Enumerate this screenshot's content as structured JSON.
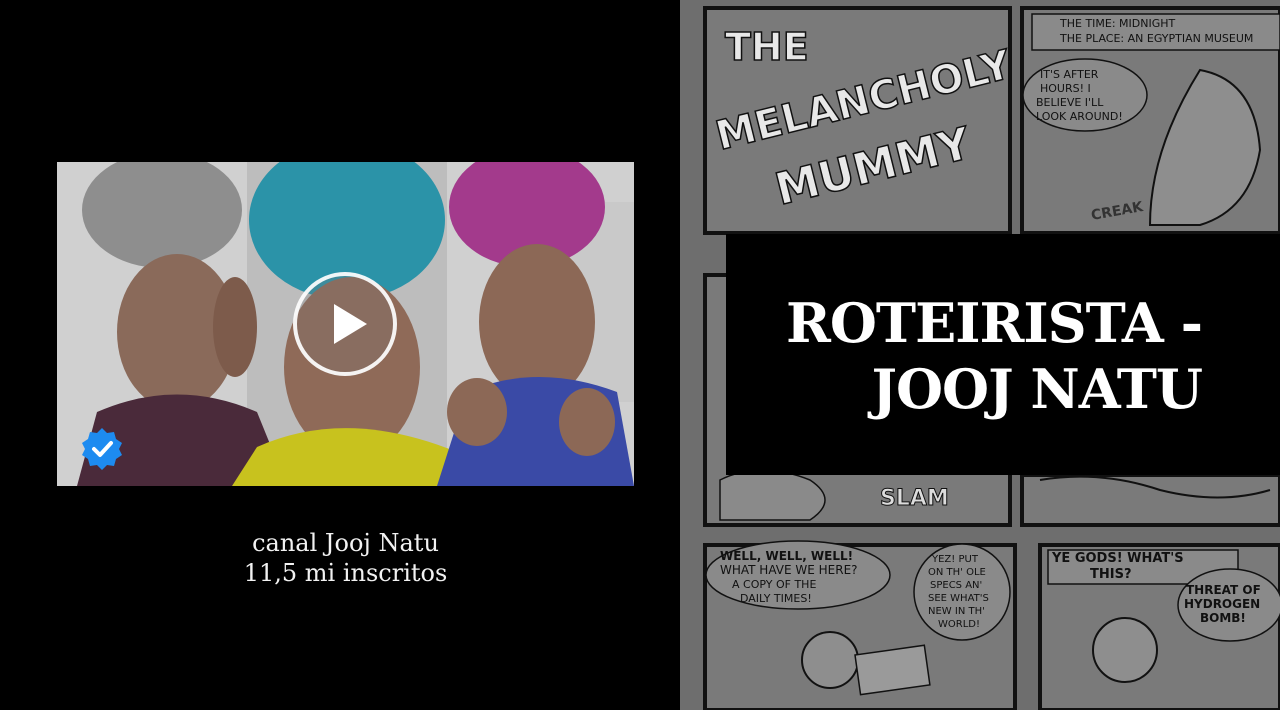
{
  "caption": {
    "line1": "canal Jooj Natu",
    "line2": "11,5 mi inscritos"
  },
  "title": {
    "line1": "ROTEIRISTA -",
    "line2": "JOOJ NATU"
  },
  "comic": {
    "logo_line1": "THE",
    "logo_line2": "MELANCHOLY",
    "logo_line3": "MUMMY",
    "bubble_time": "THE TIME: MIDNIGHT",
    "bubble_place": "THE PLACE: AN EGYPTIAN MUSEUM",
    "bubble_hours_1": "IT'S AFTER",
    "bubble_hours_2": "HOURS! I",
    "bubble_hours_3": "BELIEVE I'LL",
    "bubble_hours_4": "LOOK AROUND!",
    "sfx_creak": "CREAK",
    "sfx_slam": "SLAM",
    "bubble_well_1": "WELL, WELL, WELL!",
    "bubble_well_2": "WHAT HAVE WE HERE?",
    "bubble_well_3": "A COPY OF THE",
    "bubble_well_4": "DAILY TIMES!",
    "bubble_specs_1": "YEZ! PUT",
    "bubble_specs_2": "ON TH' OLE",
    "bubble_specs_3": "SPECS AN'",
    "bubble_specs_4": "SEE WHAT'S",
    "bubble_specs_5": "NEW IN TH'",
    "bubble_specs_6": "WORLD!",
    "bubble_gods_1": "YE GODS! WHAT'S",
    "bubble_gods_2": "THIS?",
    "bubble_threat_1": "THREAT OF",
    "bubble_threat_2": "HYDROGEN",
    "bubble_threat_3": "BOMB!"
  },
  "icons": {
    "play": "play-icon",
    "verified": "verified-badge-icon"
  },
  "colors": {
    "background": "#000000",
    "comic_gray": "#6e6e6e",
    "badge_blue": "#1d8bf0",
    "hair_teal": "#2b93a8",
    "hair_magenta": "#a33a8c",
    "shirt_yellow": "#c8c21e"
  }
}
